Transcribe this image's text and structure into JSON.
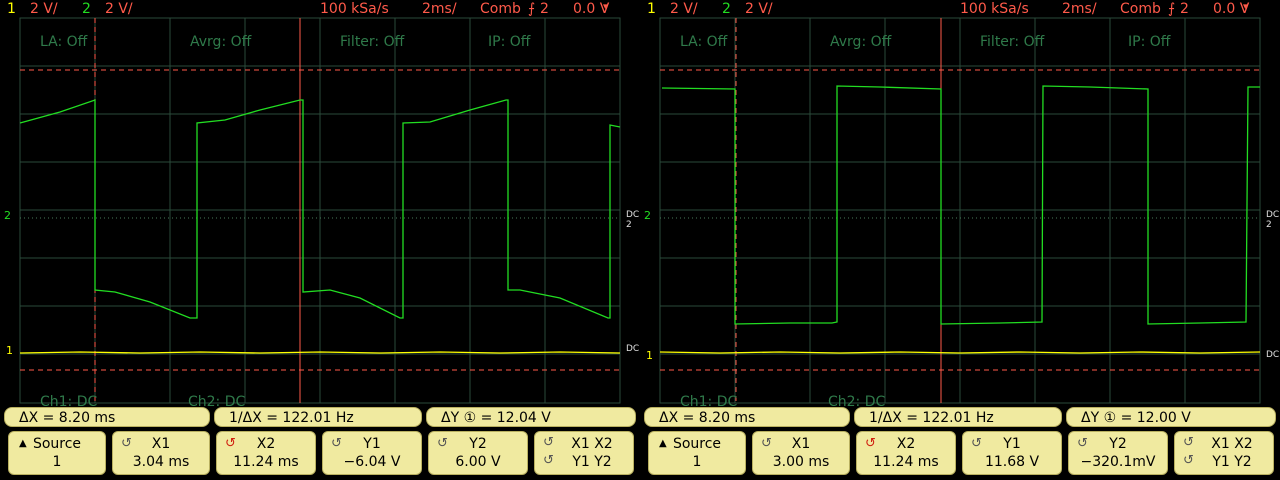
{
  "scopes": [
    {
      "header": {
        "ch1_num": "1",
        "ch1_scale": "2 V/",
        "ch2_num": "2",
        "ch2_scale": "2 V/",
        "sample_rate": "100 kSa/s",
        "timebase": "2ms/",
        "trigger_mode": "Comb",
        "trigger_src": "2",
        "trigger_level": "0.0 V"
      },
      "overlay": {
        "la": "LA: Off",
        "avrg": "Avrg: Off",
        "filter": "Filter: Off",
        "ip": "IP: Off",
        "ch1_coupling": "Ch1: DC",
        "ch2_coupling": "Ch2: DC"
      },
      "markers": {
        "ch2_left": "2",
        "ch1_left": "1",
        "dc_ch2": "DC 2",
        "dc_ch1": "DC"
      },
      "measure": {
        "dx": "ΔX =  8.20 ms",
        "inv_dx": "1/ΔX = 122.01 Hz",
        "dy": "ΔY ① = 12.04  V"
      },
      "buttons": {
        "source_label": "Source",
        "source_value": "1",
        "x1_label": "X1",
        "x1_value": "3.04 ms",
        "x2_label": "X2",
        "x2_value": "11.24 ms",
        "y1_label": "Y1",
        "y1_value": "−6.04  V",
        "y2_label": "Y2",
        "y2_value": "6.00  V",
        "pair_top": "X1  X2",
        "pair_bottom": "Y1  Y2"
      }
    },
    {
      "header": {
        "ch1_num": "1",
        "ch1_scale": "2 V/",
        "ch2_num": "2",
        "ch2_scale": "2 V/",
        "sample_rate": "100 kSa/s",
        "timebase": "2ms/",
        "trigger_mode": "Comb",
        "trigger_src": "2",
        "trigger_level": "0.0 V"
      },
      "overlay": {
        "la": "LA: Off",
        "avrg": "Avrg: Off",
        "filter": "Filter: Off",
        "ip": "IP: Off",
        "ch1_coupling": "Ch1: DC",
        "ch2_coupling": "Ch2: DC"
      },
      "markers": {
        "ch2_left": "2",
        "ch1_left": "1",
        "dc_ch2": "DC 2",
        "dc_ch1": "DC"
      },
      "measure": {
        "dx": "ΔX =  8.20 ms",
        "inv_dx": "1/ΔX = 122.01 Hz",
        "dy": "ΔY ① = 12.00  V"
      },
      "buttons": {
        "source_label": "Source",
        "source_value": "1",
        "x1_label": "X1",
        "x1_value": "3.00 ms",
        "x2_label": "X2",
        "x2_value": "11.24 ms",
        "y1_label": "Y1",
        "y1_value": "11.68  V",
        "y2_label": "Y2",
        "y2_value": "−320.1mV",
        "pair_top": "X1  X2",
        "pair_bottom": "Y1  Y2"
      }
    }
  ],
  "colors": {
    "ch1": "#ffff00",
    "ch2": "#22dd22",
    "cursor": "#ff5a4a",
    "grid": "#2a4a3a",
    "panel": "#f0eaa0"
  }
}
